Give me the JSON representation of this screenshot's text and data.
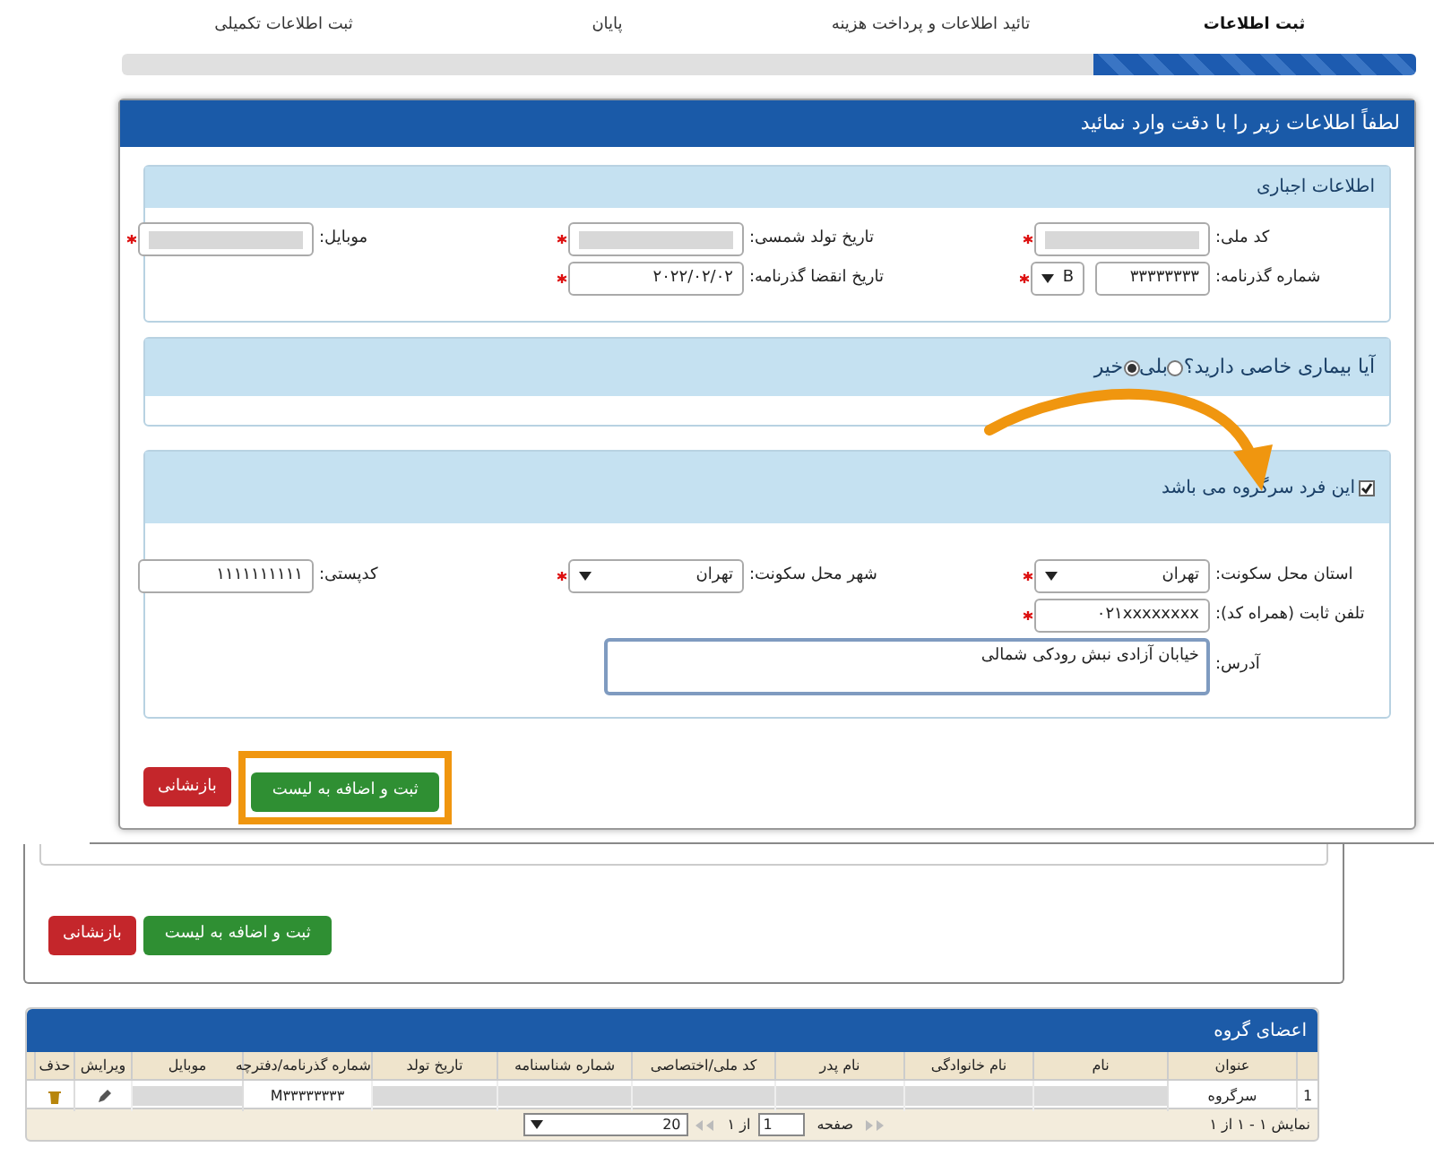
{
  "steps": [
    {
      "label": "ثبت اطلاعات",
      "selected": true
    },
    {
      "label": "تائید اطلاعات و پرداخت هزینه",
      "selected": false
    },
    {
      "label": "پایان",
      "selected": false
    },
    {
      "label": "ثبت اطلاعات تکمیلی",
      "selected": false
    }
  ],
  "progress": {
    "level": 0.25
  },
  "main_panel": {
    "title": "لطفاً اطلاعات زیر را با دقت وارد نمائید",
    "required_section": {
      "title": "اطلاعات اجباری",
      "rows": [
        [
          {
            "kind": "text",
            "label": "کد ملی:",
            "redacted": true,
            "required": true
          },
          {
            "kind": "text",
            "label": "تاریخ تولد شمسی:",
            "redacted": true,
            "required": true
          },
          {
            "kind": "text",
            "label": "موبایل:",
            "redacted": true,
            "required": true
          }
        ],
        [
          {
            "kind": "passport",
            "label": "شماره گذرنامه:",
            "value": "۳۳۳۳۳۳۳۳",
            "series": "B",
            "redacted": false,
            "required": true
          },
          {
            "kind": "text",
            "label": "تاریخ انقضا گذرنامه:",
            "value": "۲۰۲۲/۰۲/۰۲",
            "redacted": false,
            "required": true
          }
        ]
      ]
    },
    "illness_question": {
      "text": "آیا بیماری خاصی دارید؟",
      "options": [
        {
          "label": "بلی",
          "selected": false
        },
        {
          "label": "خیر",
          "selected": true
        }
      ]
    },
    "head_section": {
      "checkbox": {
        "label": "این فرد سرگروه می باشد",
        "checked": true
      },
      "rows": [
        [
          {
            "kind": "select",
            "label": "استان محل سکونت:",
            "value": "تهران",
            "redacted": false,
            "required": true
          },
          {
            "kind": "select",
            "label": "شهر محل سکونت:",
            "value": "تهران",
            "redacted": false,
            "required": true
          },
          {
            "kind": "text",
            "label": "کدپستی:",
            "value": "۱۱۱۱۱۱۱۱۱۱",
            "redacted": false,
            "required": false
          }
        ],
        [
          {
            "kind": "text",
            "label": "تلفن ثابت (همراه کد):",
            "value": "۰۲۱xxxxxxxx",
            "redacted": false,
            "required": true
          }
        ],
        [
          {
            "kind": "textarea",
            "label": "آدرس:",
            "value": "خیابان آزادی نبش رودکی شمالی",
            "redacted": false,
            "required": false
          }
        ]
      ]
    },
    "buttons": {
      "submit": "ثبت و اضافه به لیست",
      "reset": "بازنشانی"
    }
  },
  "lower_panel": {
    "buttons": {
      "submit": "ثبت و اضافه به لیست",
      "reset": "بازنشانی"
    }
  },
  "group_table": {
    "title": "اعضای گروه",
    "columns": [
      "",
      "عنوان",
      "نام",
      "نام خانوادگی",
      "نام پدر",
      "کد ملی/اختصاصی",
      "شماره شناسنامه",
      "تاریخ تولد",
      "شماره گذرنامه/دفترچه",
      "موبایل",
      "ویرایش",
      "حذف"
    ],
    "rows": [
      {
        "cells": [
          {
            "kind": "text",
            "text": "1"
          },
          {
            "kind": "text",
            "text": "سرگروه"
          },
          {
            "kind": "redacted"
          },
          {
            "kind": "redacted"
          },
          {
            "kind": "redacted"
          },
          {
            "kind": "redacted"
          },
          {
            "kind": "redacted"
          },
          {
            "kind": "redacted"
          },
          {
            "kind": "text",
            "text": "M۳۳۳۳۳۳۳۳"
          },
          {
            "kind": "redacted"
          },
          {
            "kind": "edit"
          },
          {
            "kind": "delete"
          }
        ]
      }
    ],
    "pager": {
      "summary": "نمایش ۱ - ۱ از ۱",
      "page_label": "صفحه",
      "page": "1",
      "of": "از ۱",
      "page_size": "20"
    }
  }
}
